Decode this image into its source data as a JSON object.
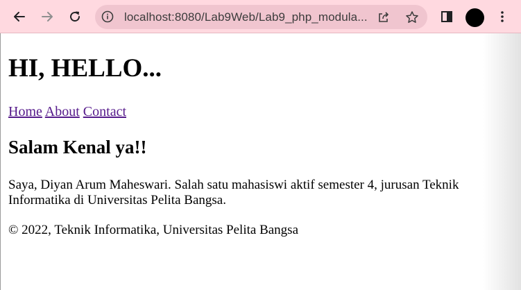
{
  "browser": {
    "url": "localhost:8080/Lab9Web/Lab9_php_modula...",
    "toolbar_color": "#ffd9e0",
    "icons": [
      "back-icon",
      "forward-icon",
      "reload-icon",
      "info-icon",
      "share-icon",
      "star-icon",
      "side-panel-icon",
      "profile-avatar",
      "menu-icon"
    ]
  },
  "page": {
    "title": "HI, HELLO...",
    "nav": [
      {
        "label": "Home"
      },
      {
        "label": "About"
      },
      {
        "label": "Contact"
      }
    ],
    "heading": "Salam Kenal ya!!",
    "intro": "Saya, Diyan Arum Maheswari. Salah satu mahasiswi aktif semester 4, jurusan Teknik Informatika di Universitas Pelita Bangsa.",
    "footer": "© 2022, Teknik Informatika, Universitas Pelita Bangsa",
    "link_color": "#551a8b"
  }
}
